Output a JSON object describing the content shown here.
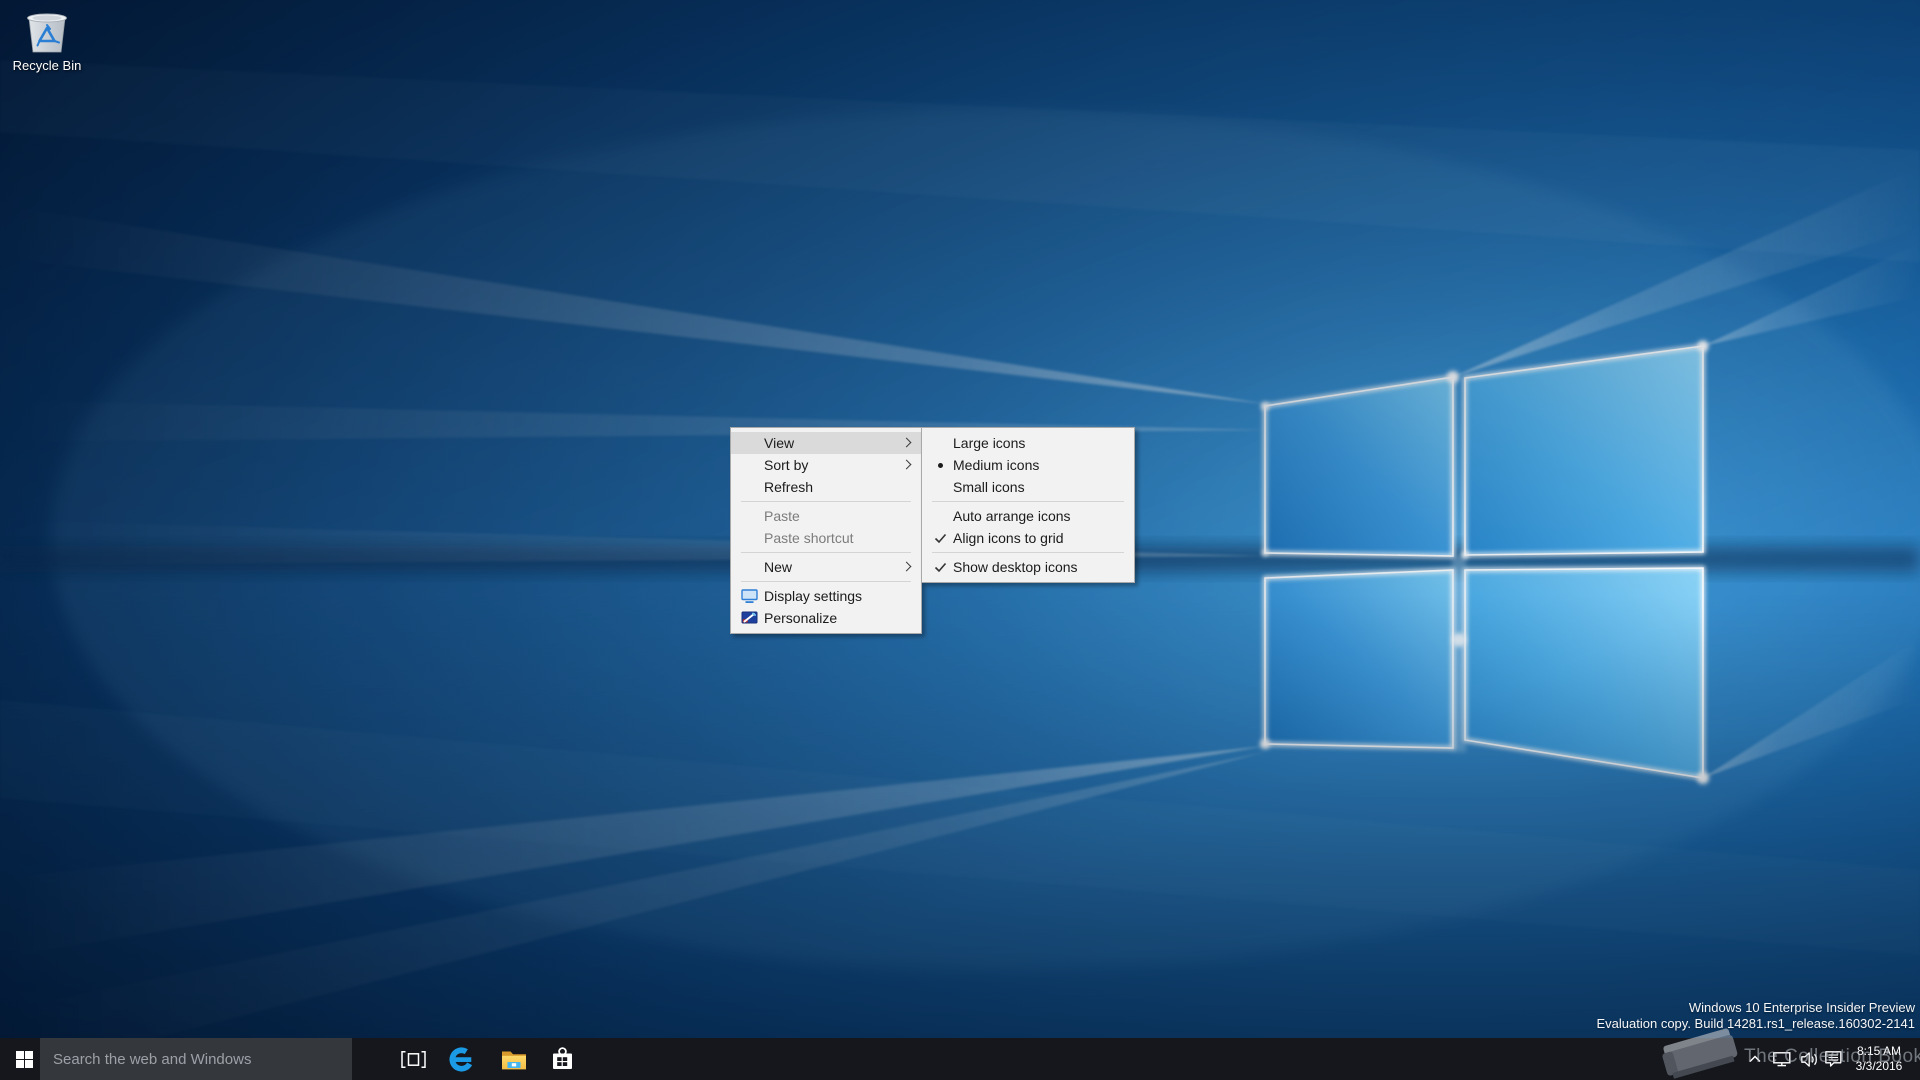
{
  "desktop": {
    "recycle_bin": {
      "label": "Recycle Bin"
    }
  },
  "context_menu": {
    "items": [
      {
        "label": "View",
        "has_submenu": true,
        "state": "highlighted"
      },
      {
        "label": "Sort by",
        "has_submenu": true
      },
      {
        "label": "Refresh"
      },
      {
        "type": "separator"
      },
      {
        "label": "Paste",
        "disabled": true
      },
      {
        "label": "Paste shortcut",
        "disabled": true
      },
      {
        "type": "separator"
      },
      {
        "label": "New",
        "has_submenu": true
      },
      {
        "type": "separator"
      },
      {
        "label": "Display settings",
        "icon": "display-settings-icon"
      },
      {
        "label": "Personalize",
        "icon": "personalize-icon"
      }
    ]
  },
  "view_submenu": {
    "items": [
      {
        "label": "Large icons"
      },
      {
        "label": "Medium icons",
        "marker": "bullet"
      },
      {
        "label": "Small icons"
      },
      {
        "type": "separator"
      },
      {
        "label": "Auto arrange icons"
      },
      {
        "label": "Align icons to grid",
        "marker": "check"
      },
      {
        "type": "separator"
      },
      {
        "label": "Show desktop icons",
        "marker": "check"
      }
    ]
  },
  "taskbar": {
    "search": {
      "placeholder": "Search the web and Windows"
    },
    "buttons": [
      "start",
      "task-view",
      "edge",
      "file-explorer",
      "store"
    ],
    "tray_icons": [
      "chevron-up",
      "network",
      "volume",
      "action-center"
    ],
    "clock": {
      "time": "8:15 AM",
      "date": "3/3/2016"
    }
  },
  "watermark": {
    "line1": "Windows 10 Enterprise Insider Preview",
    "line2": "Evaluation copy. Build 14281.rs1_release.160302-2141"
  },
  "overlay_watermark": {
    "text": "The Collection Book"
  },
  "colors": {
    "menu_bg": "#f2f2f2",
    "menu_highlight": "#dadada",
    "menu_border": "#a9a9a9",
    "taskbar_bg": "#15171c",
    "search_box_bg": "#34373c",
    "edge_blue": "#1b9be6",
    "wallpaper_deep_blue": "#07335f"
  }
}
